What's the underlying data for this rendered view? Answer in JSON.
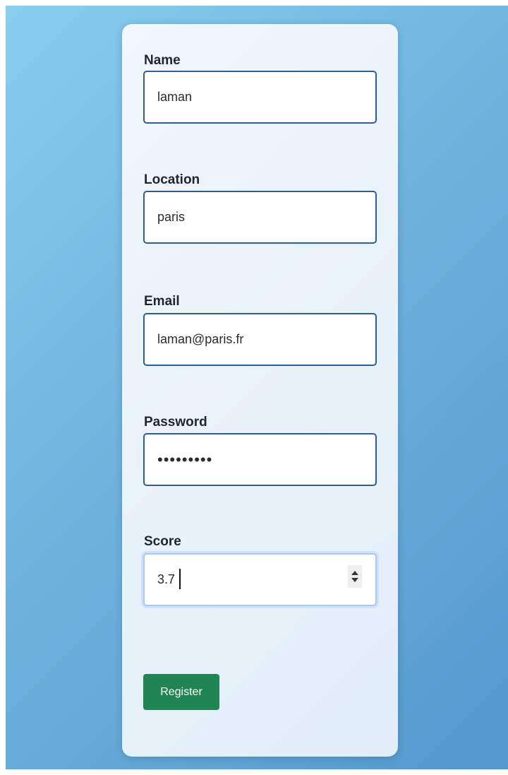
{
  "form": {
    "fields": [
      {
        "label": "Name",
        "value": "laman"
      },
      {
        "label": "Location",
        "value": "paris"
      },
      {
        "label": "Email",
        "value": "laman@paris.fr"
      },
      {
        "label": "Password",
        "value": "•••••••••"
      },
      {
        "label": "Score",
        "value": "3.7"
      }
    ],
    "submit_label": "Register"
  },
  "colors": {
    "background_gradient_start": "#89cdee",
    "background_gradient_end": "#5499cd",
    "input_border": "#2b5e96",
    "focused_border": "#a9c9f3",
    "button": "#208552"
  },
  "icons": {
    "score_stepper": "spin-up-down-icon"
  }
}
